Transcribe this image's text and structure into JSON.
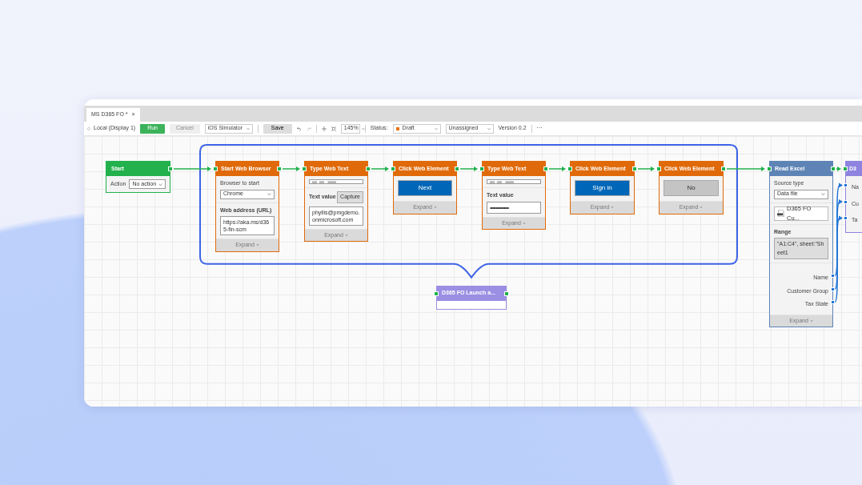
{
  "tab": {
    "label": "MS D365 FO *",
    "close": "×",
    "selected": true
  },
  "toolbar": {
    "target": "Local (Display 1)",
    "run": {
      "label": "Run",
      "disabled": false
    },
    "cancel": {
      "label": "Cancel",
      "disabled": true
    },
    "device": "iOS Simulator",
    "save": "Save",
    "zoom": "145%",
    "status_label": "Status:",
    "status": "Draft",
    "assignee": "Unassigned",
    "version": "Version 0.2",
    "more": "···"
  },
  "nodes": [
    {
      "kind": "trigger",
      "title": "Start",
      "selected": false,
      "rows": [
        {
          "kind": "inline-select",
          "label": "Action",
          "value": "No action"
        }
      ]
    },
    {
      "kind": "browser-action",
      "title": "Start Web Browser",
      "selected": true,
      "rows": [
        {
          "kind": "select",
          "label": "Browser to start",
          "value": "Chrome"
        },
        {
          "kind": "textarea",
          "label": "Web address (URL)",
          "value": "https://aka.ms/d365-fin-scm"
        }
      ],
      "expand": "Expand"
    },
    {
      "kind": "browser-action",
      "title": "Type Web Text",
      "selected": true,
      "rows": [
        {
          "kind": "thumbnail"
        },
        {
          "kind": "capture-text",
          "label": "Text value",
          "button": "Capture",
          "value": "phyllis@pmgdemo.onmicrosoft.com"
        }
      ],
      "expand": "Expand"
    },
    {
      "kind": "browser-action",
      "title": "Click Web Element",
      "selected": true,
      "rows": [
        {
          "kind": "preview",
          "text": "Next"
        }
      ],
      "expand": "Expand"
    },
    {
      "kind": "browser-action",
      "title": "Type Web Text",
      "selected": true,
      "rows": [
        {
          "kind": "thumbnail"
        },
        {
          "kind": "password",
          "label": "Text value",
          "value": "••••••••••••••••"
        }
      ],
      "expand": "Expand"
    },
    {
      "kind": "browser-action",
      "title": "Click Web Element",
      "selected": true,
      "rows": [
        {
          "kind": "preview",
          "text": "Sign in"
        }
      ],
      "expand": "Expand"
    },
    {
      "kind": "browser-action",
      "title": "Click Web Element",
      "selected": true,
      "rows": [
        {
          "kind": "preview-muted",
          "text": "No"
        }
      ],
      "expand": "Expand"
    },
    {
      "kind": "excel-action",
      "title": "Read Excel",
      "selected": false,
      "rows": [
        {
          "kind": "select",
          "label": "Source type",
          "value": "Data file"
        },
        {
          "kind": "file",
          "value": "D365 FO Cu..."
        },
        {
          "kind": "range",
          "label": "Range",
          "value": "\"A1:C4\", sheet:\"Sheet1"
        },
        {
          "kind": "outputs",
          "items": [
            "Name",
            "Customer Group",
            "Tax State"
          ]
        }
      ],
      "expand": "Expand"
    },
    {
      "kind": "subflow",
      "title": "D3",
      "selected": false,
      "rows": [
        {
          "kind": "inputs",
          "items": [
            "Na",
            "Cu",
            "Ta"
          ]
        }
      ]
    },
    {
      "kind": "group",
      "title": "D365 FO Launch a...",
      "selected": false
    }
  ]
}
